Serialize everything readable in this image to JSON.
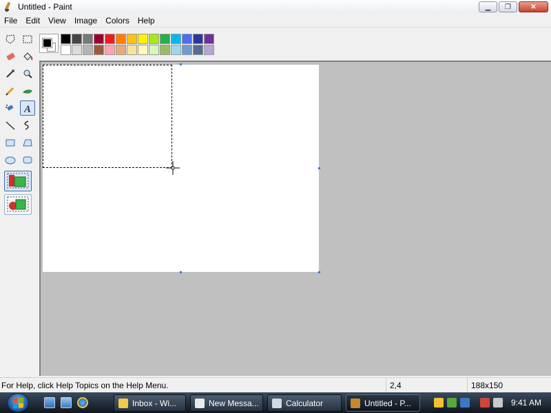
{
  "window": {
    "title": "Untitled - Paint",
    "controls": {
      "minimize": "▁",
      "maximize": "❐",
      "close": "✕"
    }
  },
  "menu": [
    "File",
    "Edit",
    "View",
    "Image",
    "Colors",
    "Help"
  ],
  "palette": {
    "foreground": "#000000",
    "background": "#ffffff",
    "row1": [
      "#000000",
      "#464646",
      "#787878",
      "#990030",
      "#ed1c24",
      "#ff7e00",
      "#ffc20e",
      "#fff200",
      "#a8e61d",
      "#22b14c",
      "#00b7ef",
      "#4d6df3",
      "#2f3699",
      "#6f3198"
    ],
    "row2": [
      "#ffffff",
      "#dcdcdc",
      "#b4b4b4",
      "#9c5a3c",
      "#ffa3b1",
      "#e5aa7a",
      "#f5e49c",
      "#fff9bd",
      "#d3f9bc",
      "#9dbb61",
      "#99d9ea",
      "#709ad1",
      "#546d8e",
      "#b5a5d5"
    ]
  },
  "tools": [
    {
      "name": "free-select-icon"
    },
    {
      "name": "rect-select-icon"
    },
    {
      "name": "eraser-icon"
    },
    {
      "name": "fill-icon"
    },
    {
      "name": "color-picker-icon"
    },
    {
      "name": "magnifier-icon"
    },
    {
      "name": "pencil-icon"
    },
    {
      "name": "brush-icon"
    },
    {
      "name": "airbrush-icon"
    },
    {
      "name": "text-icon",
      "active": true
    },
    {
      "name": "line-icon"
    },
    {
      "name": "curve-icon"
    },
    {
      "name": "rectangle-icon"
    },
    {
      "name": "polygon-icon"
    },
    {
      "name": "ellipse-icon"
    },
    {
      "name": "rounded-rect-icon"
    }
  ],
  "text_tool_label": "A",
  "status": {
    "help": "For Help, click Help Topics on the Help Menu.",
    "position": "2,4",
    "size": "188x150"
  },
  "taskbar": {
    "buttons": [
      {
        "label": "Inbox - Wi...",
        "color": "#f2c94c"
      },
      {
        "label": "New Messa...",
        "color": "#e9e9e9"
      },
      {
        "label": "Calculator",
        "color": "#cfd8e3"
      },
      {
        "label": "Untitled - P...",
        "color": "#c8892e",
        "active": true
      }
    ],
    "clock": "9:41 AM"
  }
}
